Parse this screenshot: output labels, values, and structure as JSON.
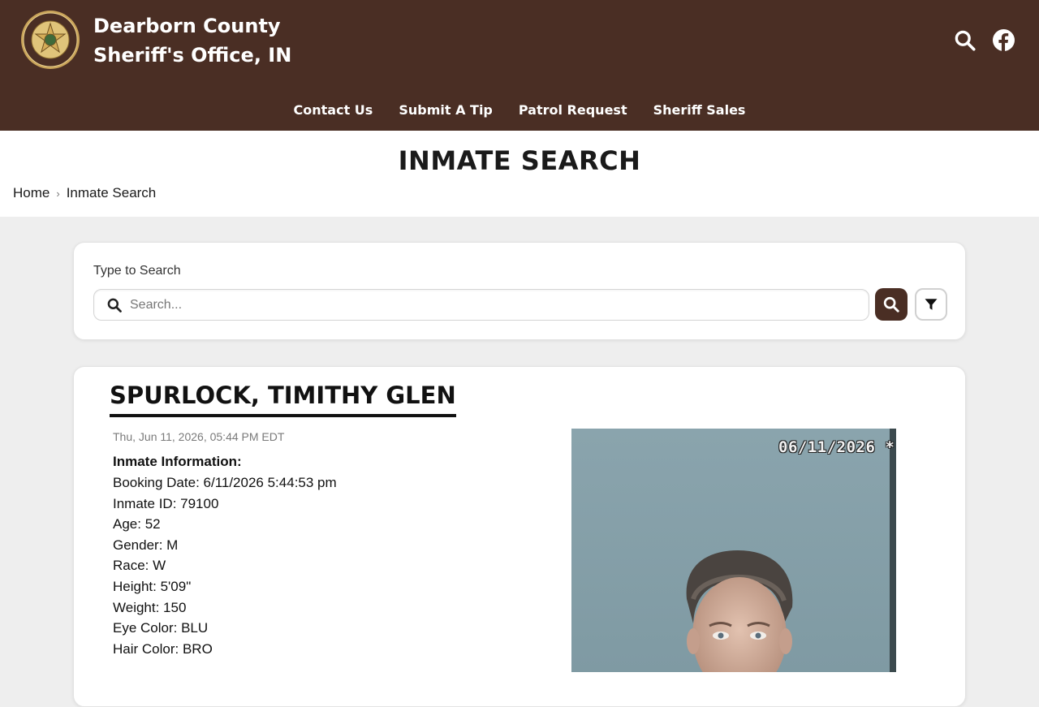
{
  "header": {
    "title_line1": "Dearborn County",
    "title_line2": "Sheriff's Office, IN",
    "seal_text_top": "DEARBORN",
    "seal_text_bottom": "COUNTY",
    "brand_color": "#4a2e24",
    "icons": [
      "search-icon",
      "facebook-icon"
    ]
  },
  "nav": {
    "items": [
      {
        "label": "Contact Us"
      },
      {
        "label": "Submit A Tip"
      },
      {
        "label": "Patrol Request"
      },
      {
        "label": "Sheriff Sales"
      }
    ]
  },
  "page": {
    "title": "INMATE SEARCH"
  },
  "breadcrumb": {
    "home": "Home",
    "current": "Inmate Search"
  },
  "search": {
    "label": "Type to Search",
    "placeholder": "Search...",
    "value": ""
  },
  "inmate": {
    "name": "SPURLOCK, TIMITHY GLEN",
    "posted": "Thu, Jun 11, 2026, 05:44 PM EDT",
    "info_heading": "Inmate Information:",
    "fields": [
      "Booking Date: 6/11/2026 5:44:53 pm",
      "Inmate ID: 79100",
      "Age: 52",
      "Gender: M",
      "Race: W",
      "Height: 5'09\"",
      "Weight: 150",
      "Eye Color: BLU",
      "Hair Color: BRO"
    ],
    "photo_timestamp": "06/11/2026 *"
  }
}
